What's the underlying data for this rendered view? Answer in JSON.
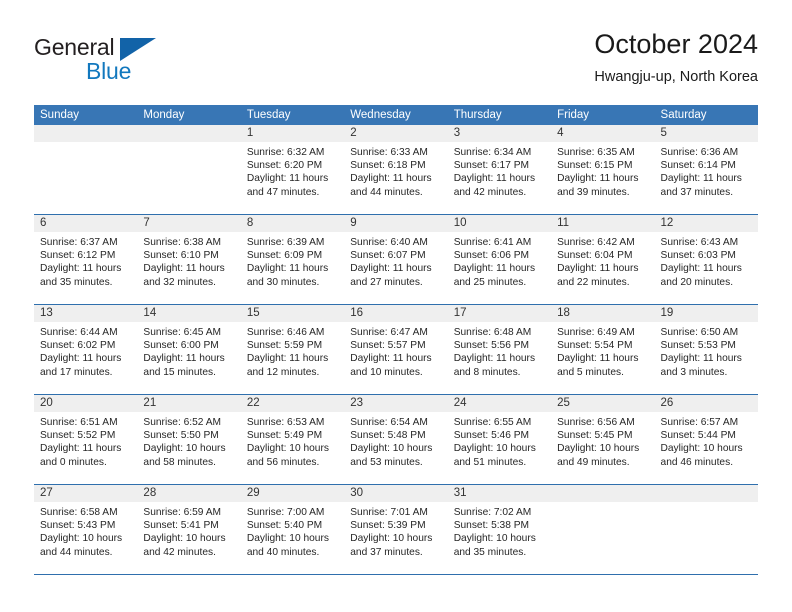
{
  "brand": {
    "name_part1": "General",
    "name_part2": "Blue",
    "triangle_icon": "triangle-logo-icon"
  },
  "header": {
    "title": "October 2024",
    "subtitle": "Hwangju-up, North Korea"
  },
  "colors": {
    "header_blue": "#3876b5",
    "rule_blue": "#2f6fad",
    "date_band": "#efefef",
    "brand_blue": "#1278be",
    "brand_dark": "#231f20"
  },
  "calendar": {
    "day_headers": [
      "Sunday",
      "Monday",
      "Tuesday",
      "Wednesday",
      "Thursday",
      "Friday",
      "Saturday"
    ],
    "weeks": [
      {
        "dates": [
          "",
          "",
          "1",
          "2",
          "3",
          "4",
          "5"
        ],
        "cells": [
          {
            "empty": true
          },
          {
            "empty": true
          },
          {
            "sunrise": "Sunrise: 6:32 AM",
            "sunset": "Sunset: 6:20 PM",
            "daylight": "Daylight: 11 hours and 47 minutes."
          },
          {
            "sunrise": "Sunrise: 6:33 AM",
            "sunset": "Sunset: 6:18 PM",
            "daylight": "Daylight: 11 hours and 44 minutes."
          },
          {
            "sunrise": "Sunrise: 6:34 AM",
            "sunset": "Sunset: 6:17 PM",
            "daylight": "Daylight: 11 hours and 42 minutes."
          },
          {
            "sunrise": "Sunrise: 6:35 AM",
            "sunset": "Sunset: 6:15 PM",
            "daylight": "Daylight: 11 hours and 39 minutes."
          },
          {
            "sunrise": "Sunrise: 6:36 AM",
            "sunset": "Sunset: 6:14 PM",
            "daylight": "Daylight: 11 hours and 37 minutes."
          }
        ]
      },
      {
        "dates": [
          "6",
          "7",
          "8",
          "9",
          "10",
          "11",
          "12"
        ],
        "cells": [
          {
            "sunrise": "Sunrise: 6:37 AM",
            "sunset": "Sunset: 6:12 PM",
            "daylight": "Daylight: 11 hours and 35 minutes."
          },
          {
            "sunrise": "Sunrise: 6:38 AM",
            "sunset": "Sunset: 6:10 PM",
            "daylight": "Daylight: 11 hours and 32 minutes."
          },
          {
            "sunrise": "Sunrise: 6:39 AM",
            "sunset": "Sunset: 6:09 PM",
            "daylight": "Daylight: 11 hours and 30 minutes."
          },
          {
            "sunrise": "Sunrise: 6:40 AM",
            "sunset": "Sunset: 6:07 PM",
            "daylight": "Daylight: 11 hours and 27 minutes."
          },
          {
            "sunrise": "Sunrise: 6:41 AM",
            "sunset": "Sunset: 6:06 PM",
            "daylight": "Daylight: 11 hours and 25 minutes."
          },
          {
            "sunrise": "Sunrise: 6:42 AM",
            "sunset": "Sunset: 6:04 PM",
            "daylight": "Daylight: 11 hours and 22 minutes."
          },
          {
            "sunrise": "Sunrise: 6:43 AM",
            "sunset": "Sunset: 6:03 PM",
            "daylight": "Daylight: 11 hours and 20 minutes."
          }
        ]
      },
      {
        "dates": [
          "13",
          "14",
          "15",
          "16",
          "17",
          "18",
          "19"
        ],
        "cells": [
          {
            "sunrise": "Sunrise: 6:44 AM",
            "sunset": "Sunset: 6:02 PM",
            "daylight": "Daylight: 11 hours and 17 minutes."
          },
          {
            "sunrise": "Sunrise: 6:45 AM",
            "sunset": "Sunset: 6:00 PM",
            "daylight": "Daylight: 11 hours and 15 minutes."
          },
          {
            "sunrise": "Sunrise: 6:46 AM",
            "sunset": "Sunset: 5:59 PM",
            "daylight": "Daylight: 11 hours and 12 minutes."
          },
          {
            "sunrise": "Sunrise: 6:47 AM",
            "sunset": "Sunset: 5:57 PM",
            "daylight": "Daylight: 11 hours and 10 minutes."
          },
          {
            "sunrise": "Sunrise: 6:48 AM",
            "sunset": "Sunset: 5:56 PM",
            "daylight": "Daylight: 11 hours and 8 minutes."
          },
          {
            "sunrise": "Sunrise: 6:49 AM",
            "sunset": "Sunset: 5:54 PM",
            "daylight": "Daylight: 11 hours and 5 minutes."
          },
          {
            "sunrise": "Sunrise: 6:50 AM",
            "sunset": "Sunset: 5:53 PM",
            "daylight": "Daylight: 11 hours and 3 minutes."
          }
        ]
      },
      {
        "dates": [
          "20",
          "21",
          "22",
          "23",
          "24",
          "25",
          "26"
        ],
        "cells": [
          {
            "sunrise": "Sunrise: 6:51 AM",
            "sunset": "Sunset: 5:52 PM",
            "daylight": "Daylight: 11 hours and 0 minutes."
          },
          {
            "sunrise": "Sunrise: 6:52 AM",
            "sunset": "Sunset: 5:50 PM",
            "daylight": "Daylight: 10 hours and 58 minutes."
          },
          {
            "sunrise": "Sunrise: 6:53 AM",
            "sunset": "Sunset: 5:49 PM",
            "daylight": "Daylight: 10 hours and 56 minutes."
          },
          {
            "sunrise": "Sunrise: 6:54 AM",
            "sunset": "Sunset: 5:48 PM",
            "daylight": "Daylight: 10 hours and 53 minutes."
          },
          {
            "sunrise": "Sunrise: 6:55 AM",
            "sunset": "Sunset: 5:46 PM",
            "daylight": "Daylight: 10 hours and 51 minutes."
          },
          {
            "sunrise": "Sunrise: 6:56 AM",
            "sunset": "Sunset: 5:45 PM",
            "daylight": "Daylight: 10 hours and 49 minutes."
          },
          {
            "sunrise": "Sunrise: 6:57 AM",
            "sunset": "Sunset: 5:44 PM",
            "daylight": "Daylight: 10 hours and 46 minutes."
          }
        ]
      },
      {
        "dates": [
          "27",
          "28",
          "29",
          "30",
          "31",
          "",
          ""
        ],
        "cells": [
          {
            "sunrise": "Sunrise: 6:58 AM",
            "sunset": "Sunset: 5:43 PM",
            "daylight": "Daylight: 10 hours and 44 minutes."
          },
          {
            "sunrise": "Sunrise: 6:59 AM",
            "sunset": "Sunset: 5:41 PM",
            "daylight": "Daylight: 10 hours and 42 minutes."
          },
          {
            "sunrise": "Sunrise: 7:00 AM",
            "sunset": "Sunset: 5:40 PM",
            "daylight": "Daylight: 10 hours and 40 minutes."
          },
          {
            "sunrise": "Sunrise: 7:01 AM",
            "sunset": "Sunset: 5:39 PM",
            "daylight": "Daylight: 10 hours and 37 minutes."
          },
          {
            "sunrise": "Sunrise: 7:02 AM",
            "sunset": "Sunset: 5:38 PM",
            "daylight": "Daylight: 10 hours and 35 minutes."
          },
          {
            "empty": true
          },
          {
            "empty": true
          }
        ]
      }
    ]
  }
}
